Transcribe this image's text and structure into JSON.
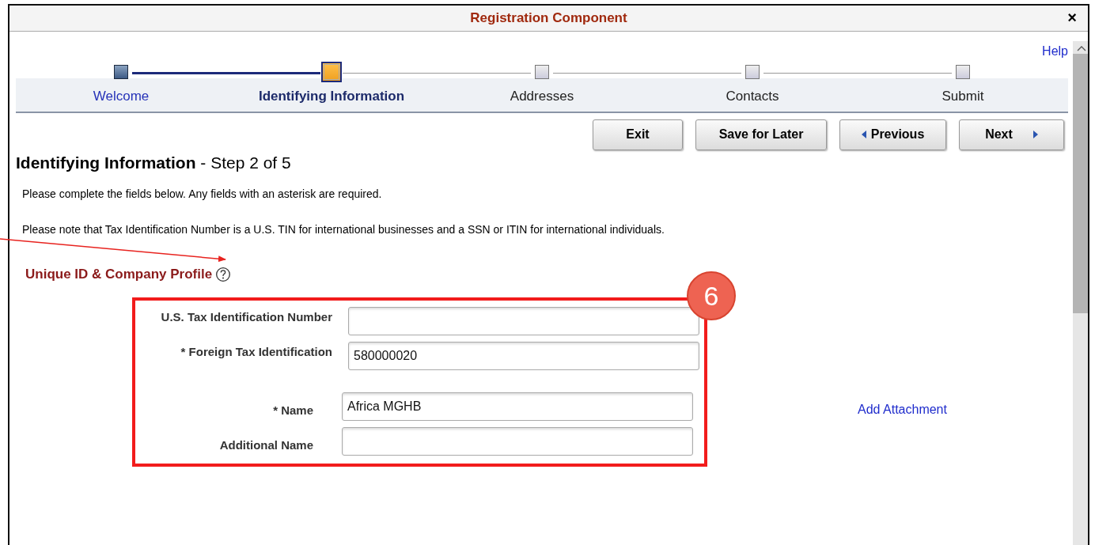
{
  "window": {
    "title": "Registration Component",
    "close": "×"
  },
  "help": "Help",
  "steps": [
    {
      "label": "Welcome",
      "completed": true,
      "selected": false
    },
    {
      "label": "Identifying Information",
      "completed": false,
      "selected": true
    },
    {
      "label": "Addresses",
      "completed": false,
      "selected": false
    },
    {
      "label": "Contacts",
      "completed": false,
      "selected": false
    },
    {
      "label": "Submit",
      "completed": false,
      "selected": false
    }
  ],
  "buttons": [
    {
      "label": "Exit",
      "kind": "plain"
    },
    {
      "label": "Save for Later",
      "kind": "plain"
    },
    {
      "label": "Previous",
      "kind": "back"
    },
    {
      "label": "Next",
      "kind": "forward"
    }
  ],
  "page_title": "**Identifying Information** - Step 2 of 5",
  "instructions": [
    "Please complete the fields below.  Any fields with an asterisk are required.",
    "Please note that Tax Identification Number is a U.S. TIN for international businesses and a SSN or ITIN for international individuals."
  ],
  "section_title": "Unique ID & Company Profile",
  "tax_fields": [
    {
      "label": "U.S. Tax Identification Number"
    },
    {
      "label": "* Foreign Tax Identification",
      "value": "580000020"
    }
  ],
  "name_fields": [
    {
      "label": "* Name",
      "value": "Africa MGHB"
    },
    {
      "label": "Additional Name"
    }
  ],
  "add_attachment": "Add Attachment",
  "callout": "6"
}
